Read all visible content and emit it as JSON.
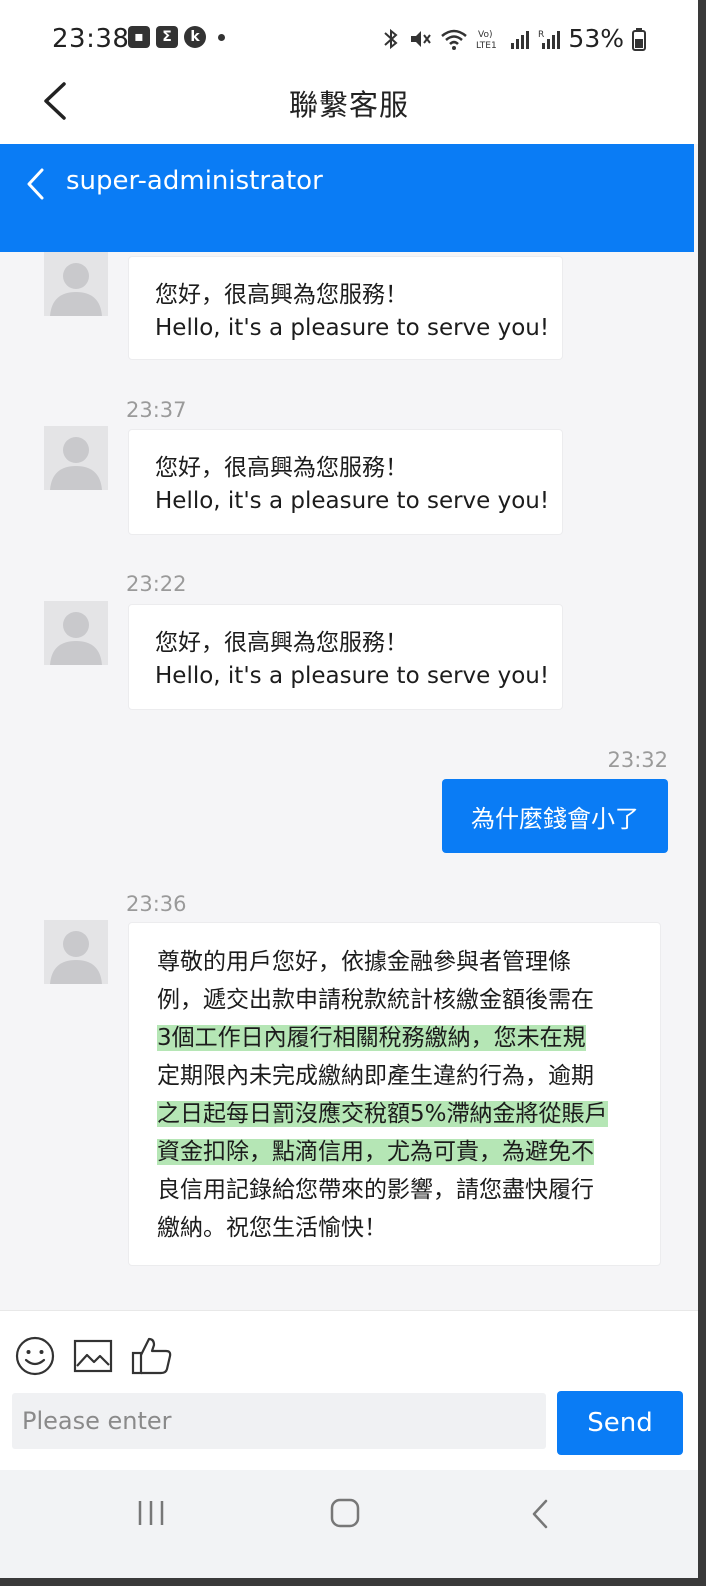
{
  "status": {
    "time": "23:38",
    "battery": "53%"
  },
  "app": {
    "title": "聯繫客服"
  },
  "chat_header": {
    "title": "super-administrator"
  },
  "messages": [
    {
      "line1": "您好，很高興為您服務！",
      "line2": "Hello, it's a pleasure to serve you!"
    },
    {
      "time": "23:37",
      "line1": "您好，很高興為您服務！",
      "line2": "Hello, it's a pleasure to serve you!"
    },
    {
      "time": "23:22",
      "line1": "您好，很高興為您服務！",
      "line2": "Hello, it's a pleasure to serve you!"
    },
    {
      "time": "23:32",
      "text": "為什麼錢會小了"
    },
    {
      "time": "23:36",
      "lines": [
        "尊敬的用戶您好，依據金融參與者管理條",
        "例，遞交出款申請稅款統計核繳金額後需在",
        "3個工作日內履行相關稅務繳納，您未在規",
        "定期限內未完成繳納即產生違約行為，逾期",
        "之日起每日罰沒應交稅額5%滯納金將從賬戶",
        "資金扣除，點滴信用，尤為可貴，為避免不",
        "良信用記錄給您帶來的影響，請您盡快履行",
        "繳納。祝您生活愉快！"
      ]
    }
  ],
  "composer": {
    "placeholder": "Please enter",
    "send_label": "Send"
  },
  "icons": {
    "emoji": "smiley-icon",
    "image": "image-icon",
    "like": "thumbs-up-icon"
  },
  "colors": {
    "accent": "#0a7cf5",
    "highlight": "#78d278"
  }
}
